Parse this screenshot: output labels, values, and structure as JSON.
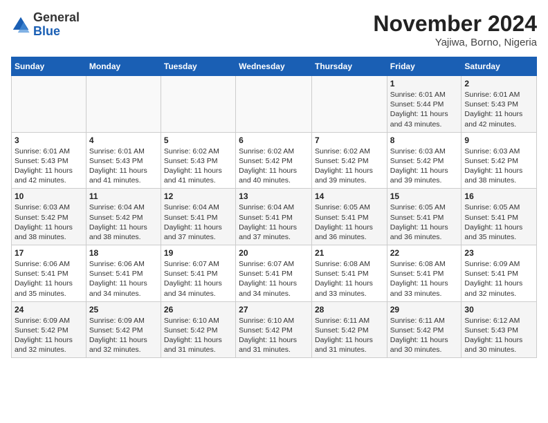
{
  "header": {
    "logo_general": "General",
    "logo_blue": "Blue",
    "month_title": "November 2024",
    "location": "Yajiwa, Borno, Nigeria"
  },
  "days_of_week": [
    "Sunday",
    "Monday",
    "Tuesday",
    "Wednesday",
    "Thursday",
    "Friday",
    "Saturday"
  ],
  "weeks": [
    [
      {
        "day": "",
        "sunrise": "",
        "sunset": "",
        "daylight": ""
      },
      {
        "day": "",
        "sunrise": "",
        "sunset": "",
        "daylight": ""
      },
      {
        "day": "",
        "sunrise": "",
        "sunset": "",
        "daylight": ""
      },
      {
        "day": "",
        "sunrise": "",
        "sunset": "",
        "daylight": ""
      },
      {
        "day": "",
        "sunrise": "",
        "sunset": "",
        "daylight": ""
      },
      {
        "day": "1",
        "sunrise": "Sunrise: 6:01 AM",
        "sunset": "Sunset: 5:44 PM",
        "daylight": "Daylight: 11 hours and 43 minutes."
      },
      {
        "day": "2",
        "sunrise": "Sunrise: 6:01 AM",
        "sunset": "Sunset: 5:43 PM",
        "daylight": "Daylight: 11 hours and 42 minutes."
      }
    ],
    [
      {
        "day": "3",
        "sunrise": "Sunrise: 6:01 AM",
        "sunset": "Sunset: 5:43 PM",
        "daylight": "Daylight: 11 hours and 42 minutes."
      },
      {
        "day": "4",
        "sunrise": "Sunrise: 6:01 AM",
        "sunset": "Sunset: 5:43 PM",
        "daylight": "Daylight: 11 hours and 41 minutes."
      },
      {
        "day": "5",
        "sunrise": "Sunrise: 6:02 AM",
        "sunset": "Sunset: 5:43 PM",
        "daylight": "Daylight: 11 hours and 41 minutes."
      },
      {
        "day": "6",
        "sunrise": "Sunrise: 6:02 AM",
        "sunset": "Sunset: 5:42 PM",
        "daylight": "Daylight: 11 hours and 40 minutes."
      },
      {
        "day": "7",
        "sunrise": "Sunrise: 6:02 AM",
        "sunset": "Sunset: 5:42 PM",
        "daylight": "Daylight: 11 hours and 39 minutes."
      },
      {
        "day": "8",
        "sunrise": "Sunrise: 6:03 AM",
        "sunset": "Sunset: 5:42 PM",
        "daylight": "Daylight: 11 hours and 39 minutes."
      },
      {
        "day": "9",
        "sunrise": "Sunrise: 6:03 AM",
        "sunset": "Sunset: 5:42 PM",
        "daylight": "Daylight: 11 hours and 38 minutes."
      }
    ],
    [
      {
        "day": "10",
        "sunrise": "Sunrise: 6:03 AM",
        "sunset": "Sunset: 5:42 PM",
        "daylight": "Daylight: 11 hours and 38 minutes."
      },
      {
        "day": "11",
        "sunrise": "Sunrise: 6:04 AM",
        "sunset": "Sunset: 5:42 PM",
        "daylight": "Daylight: 11 hours and 38 minutes."
      },
      {
        "day": "12",
        "sunrise": "Sunrise: 6:04 AM",
        "sunset": "Sunset: 5:41 PM",
        "daylight": "Daylight: 11 hours and 37 minutes."
      },
      {
        "day": "13",
        "sunrise": "Sunrise: 6:04 AM",
        "sunset": "Sunset: 5:41 PM",
        "daylight": "Daylight: 11 hours and 37 minutes."
      },
      {
        "day": "14",
        "sunrise": "Sunrise: 6:05 AM",
        "sunset": "Sunset: 5:41 PM",
        "daylight": "Daylight: 11 hours and 36 minutes."
      },
      {
        "day": "15",
        "sunrise": "Sunrise: 6:05 AM",
        "sunset": "Sunset: 5:41 PM",
        "daylight": "Daylight: 11 hours and 36 minutes."
      },
      {
        "day": "16",
        "sunrise": "Sunrise: 6:05 AM",
        "sunset": "Sunset: 5:41 PM",
        "daylight": "Daylight: 11 hours and 35 minutes."
      }
    ],
    [
      {
        "day": "17",
        "sunrise": "Sunrise: 6:06 AM",
        "sunset": "Sunset: 5:41 PM",
        "daylight": "Daylight: 11 hours and 35 minutes."
      },
      {
        "day": "18",
        "sunrise": "Sunrise: 6:06 AM",
        "sunset": "Sunset: 5:41 PM",
        "daylight": "Daylight: 11 hours and 34 minutes."
      },
      {
        "day": "19",
        "sunrise": "Sunrise: 6:07 AM",
        "sunset": "Sunset: 5:41 PM",
        "daylight": "Daylight: 11 hours and 34 minutes."
      },
      {
        "day": "20",
        "sunrise": "Sunrise: 6:07 AM",
        "sunset": "Sunset: 5:41 PM",
        "daylight": "Daylight: 11 hours and 34 minutes."
      },
      {
        "day": "21",
        "sunrise": "Sunrise: 6:08 AM",
        "sunset": "Sunset: 5:41 PM",
        "daylight": "Daylight: 11 hours and 33 minutes."
      },
      {
        "day": "22",
        "sunrise": "Sunrise: 6:08 AM",
        "sunset": "Sunset: 5:41 PM",
        "daylight": "Daylight: 11 hours and 33 minutes."
      },
      {
        "day": "23",
        "sunrise": "Sunrise: 6:09 AM",
        "sunset": "Sunset: 5:41 PM",
        "daylight": "Daylight: 11 hours and 32 minutes."
      }
    ],
    [
      {
        "day": "24",
        "sunrise": "Sunrise: 6:09 AM",
        "sunset": "Sunset: 5:42 PM",
        "daylight": "Daylight: 11 hours and 32 minutes."
      },
      {
        "day": "25",
        "sunrise": "Sunrise: 6:09 AM",
        "sunset": "Sunset: 5:42 PM",
        "daylight": "Daylight: 11 hours and 32 minutes."
      },
      {
        "day": "26",
        "sunrise": "Sunrise: 6:10 AM",
        "sunset": "Sunset: 5:42 PM",
        "daylight": "Daylight: 11 hours and 31 minutes."
      },
      {
        "day": "27",
        "sunrise": "Sunrise: 6:10 AM",
        "sunset": "Sunset: 5:42 PM",
        "daylight": "Daylight: 11 hours and 31 minutes."
      },
      {
        "day": "28",
        "sunrise": "Sunrise: 6:11 AM",
        "sunset": "Sunset: 5:42 PM",
        "daylight": "Daylight: 11 hours and 31 minutes."
      },
      {
        "day": "29",
        "sunrise": "Sunrise: 6:11 AM",
        "sunset": "Sunset: 5:42 PM",
        "daylight": "Daylight: 11 hours and 30 minutes."
      },
      {
        "day": "30",
        "sunrise": "Sunrise: 6:12 AM",
        "sunset": "Sunset: 5:43 PM",
        "daylight": "Daylight: 11 hours and 30 minutes."
      }
    ]
  ]
}
